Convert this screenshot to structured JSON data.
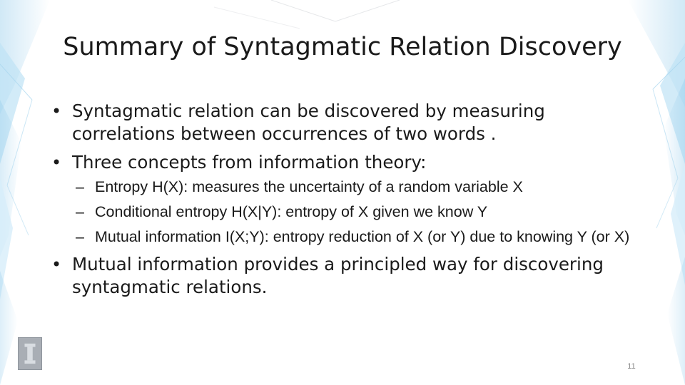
{
  "slide": {
    "title": "Summary of Syntagmatic Relation Discovery",
    "bullets": [
      {
        "text": "Syntagmatic relation can be discovered by measuring correlations between occurrences of two words ."
      },
      {
        "text": "Three concepts from information theory:",
        "subitems": [
          "Entropy H(X): measures the uncertainty of a random variable X",
          "Conditional entropy H(X|Y): entropy of X given we know Y",
          "Mutual information I(X;Y): entropy reduction of X (or Y) due to knowing Y (or X)"
        ]
      },
      {
        "text": "Mutual information provides a principled way for discovering syntagmatic relations."
      }
    ],
    "page_number": "11"
  },
  "icons": {
    "bullet": "bullet-dot-icon",
    "dash": "en-dash-icon",
    "logo": "university-i-logo-icon"
  },
  "colors": {
    "text": "#1a1a1a",
    "decor_blue": "#8fc9ea",
    "logo_gray": "#a9aeb5",
    "page_number": "#8a8a8a"
  }
}
